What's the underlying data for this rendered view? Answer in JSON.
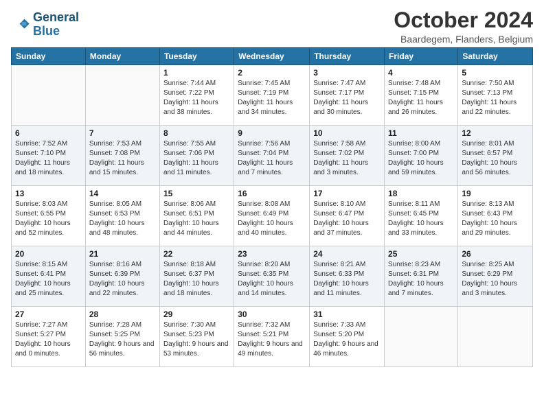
{
  "header": {
    "logo_line1": "General",
    "logo_line2": "Blue",
    "title": "October 2024",
    "location": "Baardegem, Flanders, Belgium"
  },
  "days_of_week": [
    "Sunday",
    "Monday",
    "Tuesday",
    "Wednesday",
    "Thursday",
    "Friday",
    "Saturday"
  ],
  "weeks": [
    [
      {
        "day": "",
        "info": ""
      },
      {
        "day": "",
        "info": ""
      },
      {
        "day": "1",
        "info": "Sunrise: 7:44 AM\nSunset: 7:22 PM\nDaylight: 11 hours and 38 minutes."
      },
      {
        "day": "2",
        "info": "Sunrise: 7:45 AM\nSunset: 7:19 PM\nDaylight: 11 hours and 34 minutes."
      },
      {
        "day": "3",
        "info": "Sunrise: 7:47 AM\nSunset: 7:17 PM\nDaylight: 11 hours and 30 minutes."
      },
      {
        "day": "4",
        "info": "Sunrise: 7:48 AM\nSunset: 7:15 PM\nDaylight: 11 hours and 26 minutes."
      },
      {
        "day": "5",
        "info": "Sunrise: 7:50 AM\nSunset: 7:13 PM\nDaylight: 11 hours and 22 minutes."
      }
    ],
    [
      {
        "day": "6",
        "info": "Sunrise: 7:52 AM\nSunset: 7:10 PM\nDaylight: 11 hours and 18 minutes."
      },
      {
        "day": "7",
        "info": "Sunrise: 7:53 AM\nSunset: 7:08 PM\nDaylight: 11 hours and 15 minutes."
      },
      {
        "day": "8",
        "info": "Sunrise: 7:55 AM\nSunset: 7:06 PM\nDaylight: 11 hours and 11 minutes."
      },
      {
        "day": "9",
        "info": "Sunrise: 7:56 AM\nSunset: 7:04 PM\nDaylight: 11 hours and 7 minutes."
      },
      {
        "day": "10",
        "info": "Sunrise: 7:58 AM\nSunset: 7:02 PM\nDaylight: 11 hours and 3 minutes."
      },
      {
        "day": "11",
        "info": "Sunrise: 8:00 AM\nSunset: 7:00 PM\nDaylight: 10 hours and 59 minutes."
      },
      {
        "day": "12",
        "info": "Sunrise: 8:01 AM\nSunset: 6:57 PM\nDaylight: 10 hours and 56 minutes."
      }
    ],
    [
      {
        "day": "13",
        "info": "Sunrise: 8:03 AM\nSunset: 6:55 PM\nDaylight: 10 hours and 52 minutes."
      },
      {
        "day": "14",
        "info": "Sunrise: 8:05 AM\nSunset: 6:53 PM\nDaylight: 10 hours and 48 minutes."
      },
      {
        "day": "15",
        "info": "Sunrise: 8:06 AM\nSunset: 6:51 PM\nDaylight: 10 hours and 44 minutes."
      },
      {
        "day": "16",
        "info": "Sunrise: 8:08 AM\nSunset: 6:49 PM\nDaylight: 10 hours and 40 minutes."
      },
      {
        "day": "17",
        "info": "Sunrise: 8:10 AM\nSunset: 6:47 PM\nDaylight: 10 hours and 37 minutes."
      },
      {
        "day": "18",
        "info": "Sunrise: 8:11 AM\nSunset: 6:45 PM\nDaylight: 10 hours and 33 minutes."
      },
      {
        "day": "19",
        "info": "Sunrise: 8:13 AM\nSunset: 6:43 PM\nDaylight: 10 hours and 29 minutes."
      }
    ],
    [
      {
        "day": "20",
        "info": "Sunrise: 8:15 AM\nSunset: 6:41 PM\nDaylight: 10 hours and 25 minutes."
      },
      {
        "day": "21",
        "info": "Sunrise: 8:16 AM\nSunset: 6:39 PM\nDaylight: 10 hours and 22 minutes."
      },
      {
        "day": "22",
        "info": "Sunrise: 8:18 AM\nSunset: 6:37 PM\nDaylight: 10 hours and 18 minutes."
      },
      {
        "day": "23",
        "info": "Sunrise: 8:20 AM\nSunset: 6:35 PM\nDaylight: 10 hours and 14 minutes."
      },
      {
        "day": "24",
        "info": "Sunrise: 8:21 AM\nSunset: 6:33 PM\nDaylight: 10 hours and 11 minutes."
      },
      {
        "day": "25",
        "info": "Sunrise: 8:23 AM\nSunset: 6:31 PM\nDaylight: 10 hours and 7 minutes."
      },
      {
        "day": "26",
        "info": "Sunrise: 8:25 AM\nSunset: 6:29 PM\nDaylight: 10 hours and 3 minutes."
      }
    ],
    [
      {
        "day": "27",
        "info": "Sunrise: 7:27 AM\nSunset: 5:27 PM\nDaylight: 10 hours and 0 minutes."
      },
      {
        "day": "28",
        "info": "Sunrise: 7:28 AM\nSunset: 5:25 PM\nDaylight: 9 hours and 56 minutes."
      },
      {
        "day": "29",
        "info": "Sunrise: 7:30 AM\nSunset: 5:23 PM\nDaylight: 9 hours and 53 minutes."
      },
      {
        "day": "30",
        "info": "Sunrise: 7:32 AM\nSunset: 5:21 PM\nDaylight: 9 hours and 49 minutes."
      },
      {
        "day": "31",
        "info": "Sunrise: 7:33 AM\nSunset: 5:20 PM\nDaylight: 9 hours and 46 minutes."
      },
      {
        "day": "",
        "info": ""
      },
      {
        "day": "",
        "info": ""
      }
    ]
  ]
}
